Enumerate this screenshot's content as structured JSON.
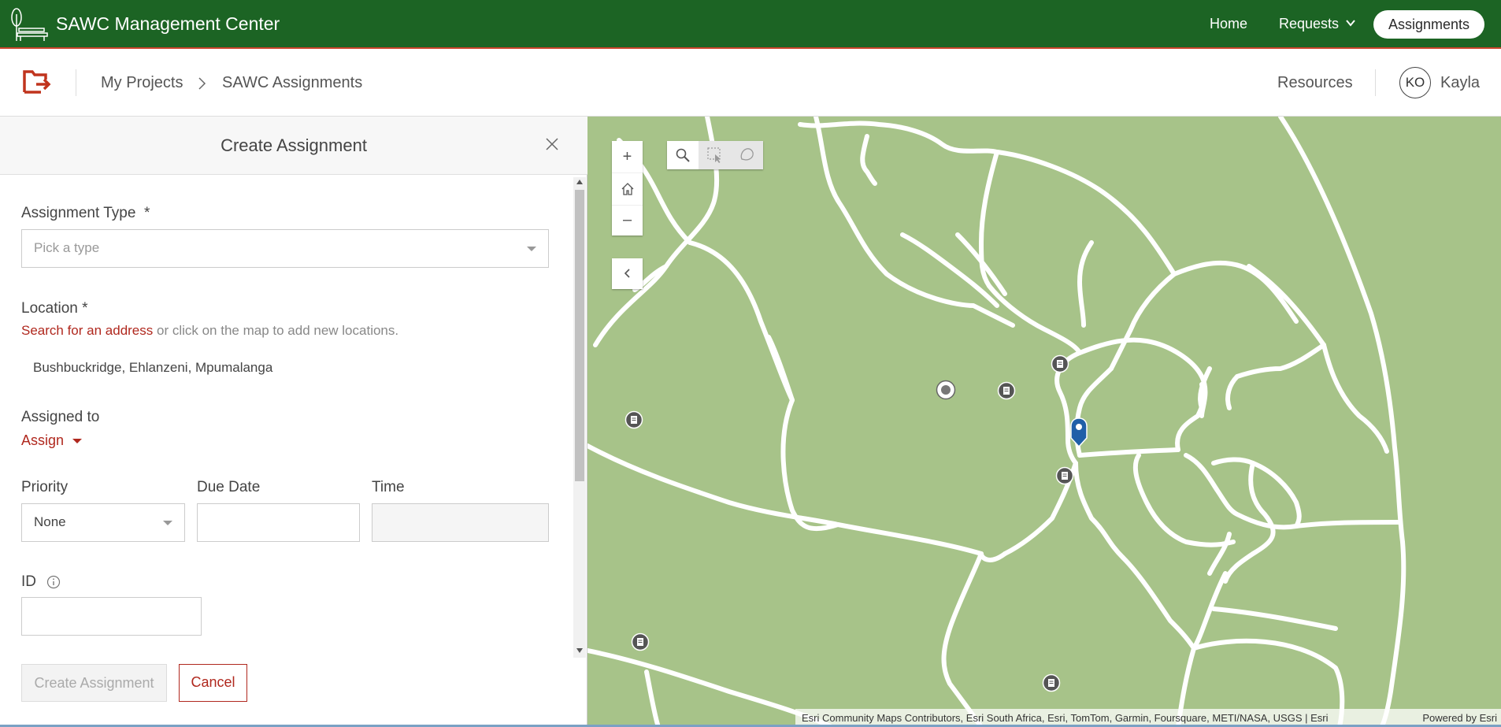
{
  "topbar": {
    "title": "SAWC Management Center",
    "nav": {
      "home": "Home",
      "requests": "Requests",
      "assignments": "Assignments"
    },
    "colors": {
      "background": "#1c6424",
      "accent_line": "#c9442b"
    }
  },
  "subheader": {
    "breadcrumb": [
      "My Projects",
      "SAWC Assignments"
    ],
    "resources": "Resources",
    "user": {
      "initials": "KO",
      "name": "Kayla"
    }
  },
  "panel": {
    "title": "Create Assignment",
    "fields": {
      "assignment_type": {
        "label": "Assignment Type",
        "required_mark": "*",
        "placeholder": "Pick a type"
      },
      "location": {
        "label": "Location *",
        "link": "Search for an address",
        "hint": " or click on the map to add new locations.",
        "value": "Bushbuckridge, Ehlanzeni, Mpumalanga"
      },
      "assigned_to": {
        "label": "Assigned to",
        "action": "Assign"
      },
      "priority": {
        "label": "Priority",
        "value": "None"
      },
      "due_date": {
        "label": "Due Date",
        "value": ""
      },
      "time": {
        "label": "Time",
        "value": ""
      },
      "id": {
        "label": "ID",
        "value": ""
      }
    },
    "buttons": {
      "create": "Create Assignment",
      "cancel": "Cancel"
    }
  },
  "map": {
    "controls": {
      "zoom_in": "+",
      "zoom_out": "–"
    },
    "tools": [
      "search-icon",
      "rectangle-select-icon",
      "lasso-select-icon"
    ],
    "attribution": "Esri Community Maps Contributors, Esri South Africa, Esri, TomTom, Garmin, Foursquare, METI/NASA, USGS | Esri",
    "powered_by": "Powered by Esri",
    "colors": {
      "land": "#a7c389",
      "road": "#ffffff",
      "marker": "#1f5fa8",
      "poi": "#555555"
    }
  }
}
